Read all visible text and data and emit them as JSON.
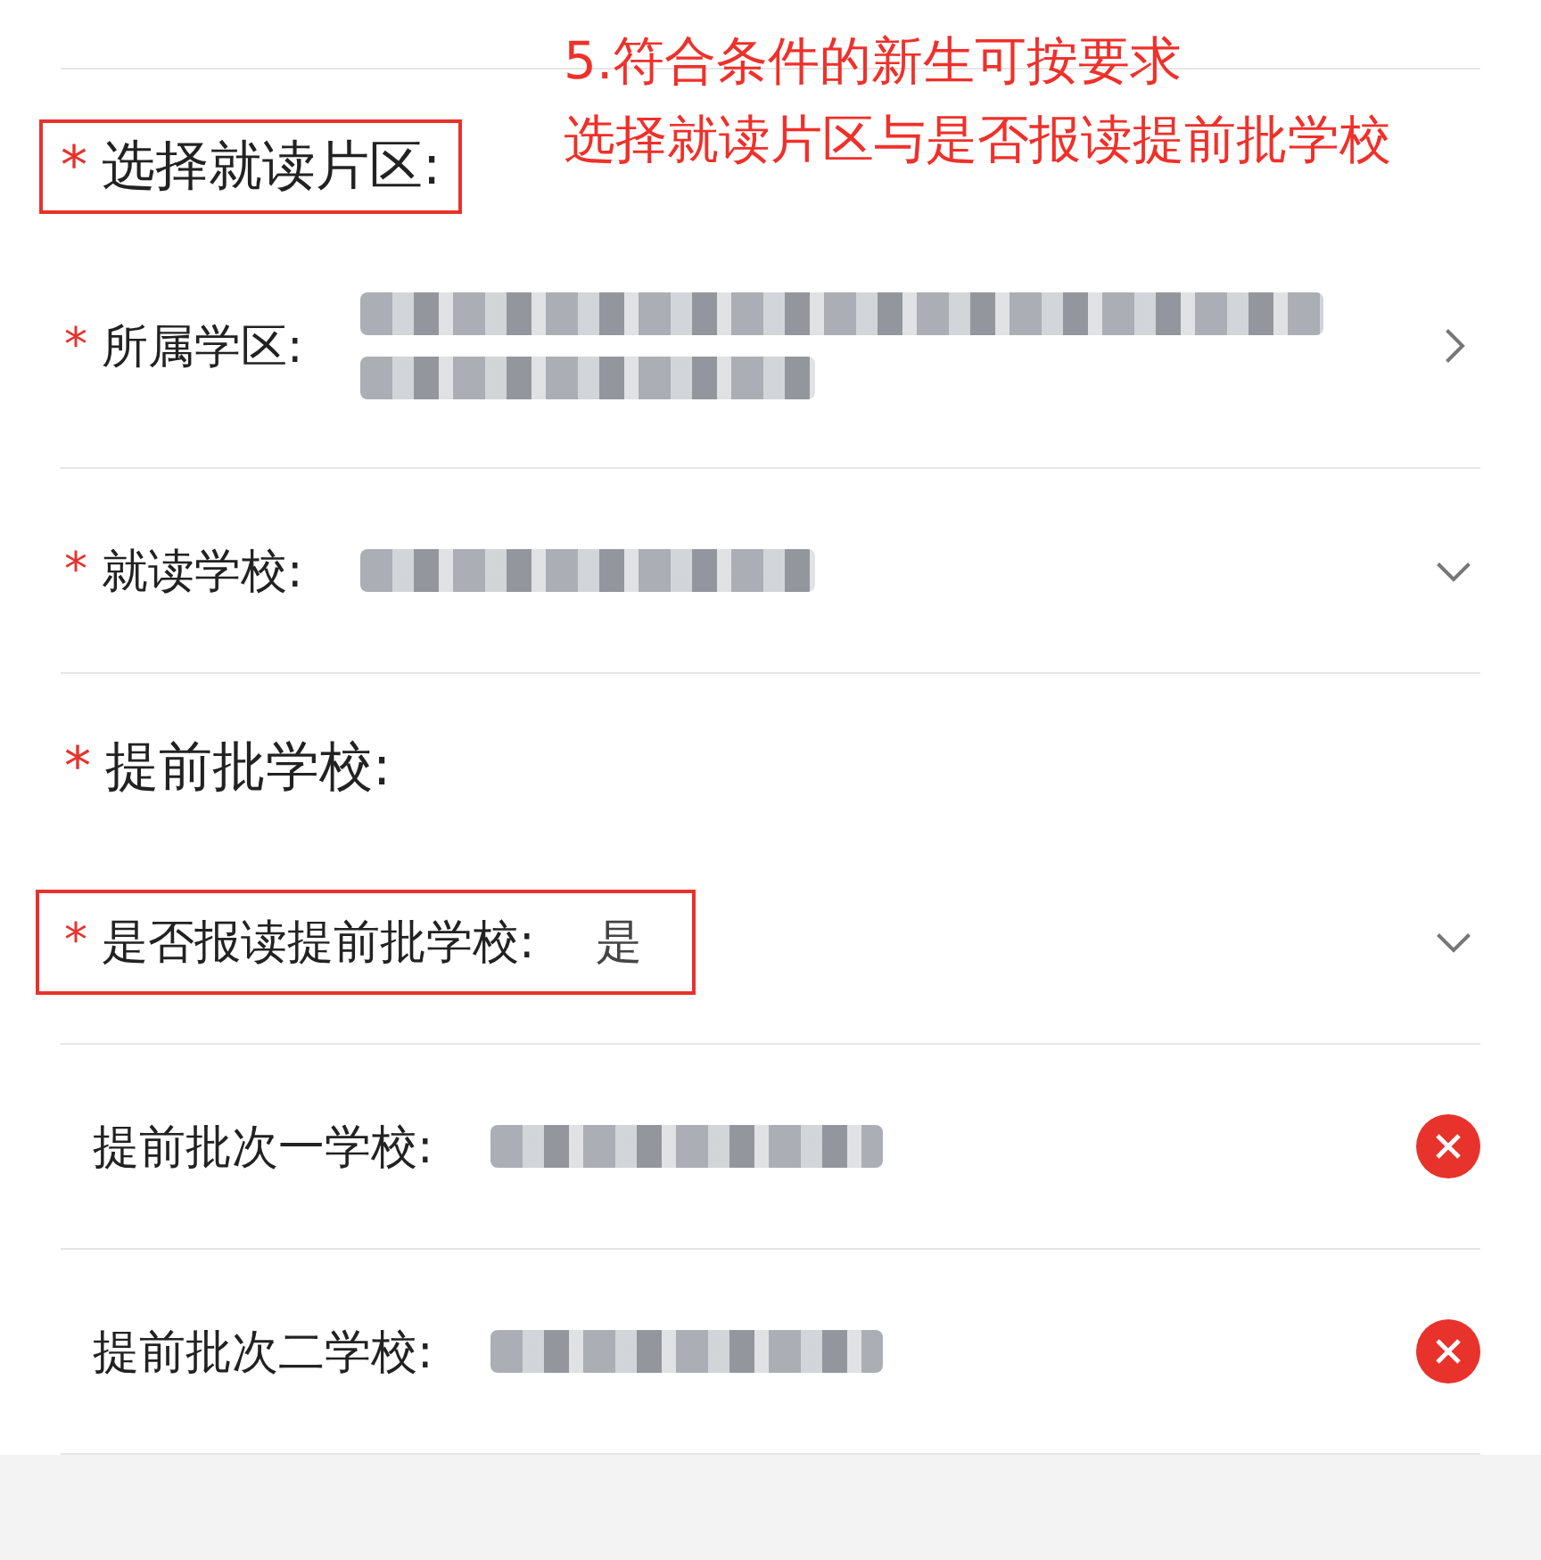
{
  "annotation": {
    "lines": [
      "5.符合条件的新生可按要求",
      "选择就读片区与是否报读提前批学校"
    ]
  },
  "sections": [
    {
      "mark": "*",
      "title": "选择就读片区:",
      "highlighted": true,
      "fields": [
        {
          "mark": "*",
          "label": "所属学区:",
          "highlighted": false,
          "redacted": true,
          "kind": "link"
        },
        {
          "mark": "*",
          "label": "就读学校:",
          "highlighted": false,
          "redacted": true,
          "kind": "select"
        }
      ]
    },
    {
      "mark": "*",
      "title": "提前批学校:",
      "highlighted": false,
      "fields": [
        {
          "mark": "*",
          "label": "是否报读提前批学校:",
          "value": "是",
          "highlighted": true,
          "redacted": false,
          "kind": "select"
        },
        {
          "label": "提前批次一学校:",
          "highlighted": false,
          "redacted": true,
          "kind": "clearable"
        },
        {
          "label": "提前批次二学校:",
          "highlighted": false,
          "redacted": true,
          "kind": "clearable"
        }
      ]
    }
  ]
}
